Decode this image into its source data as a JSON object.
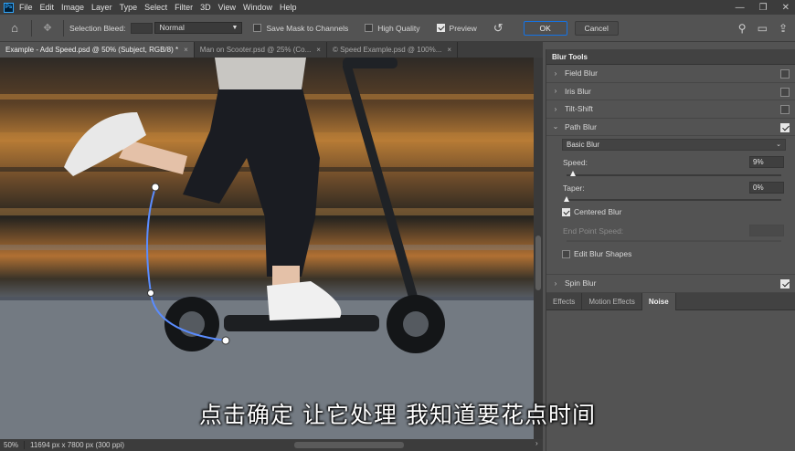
{
  "app": {
    "logo": "Ps"
  },
  "menu": [
    "File",
    "Edit",
    "Image",
    "Layer",
    "Type",
    "Select",
    "Filter",
    "3D",
    "View",
    "Window",
    "Help"
  ],
  "window_controls": {
    "minimize": "—",
    "restore": "❐",
    "close": "✕"
  },
  "options_bar": {
    "selection_bleed_label": "Selection Bleed:",
    "blend_mode": "Normal",
    "save_mask_label": "Save Mask to Channels",
    "save_mask_checked": false,
    "high_quality_label": "High Quality",
    "high_quality_checked": false,
    "preview_label": "Preview",
    "preview_checked": true,
    "ok_label": "OK",
    "cancel_label": "Cancel"
  },
  "tabs": [
    {
      "label": "Example - Add Speed.psd @ 50% (Subject, RGB/8) *",
      "active": true,
      "close": "×"
    },
    {
      "label": "Man on Scooter.psd @ 25% (Co...",
      "active": false,
      "close": "×"
    },
    {
      "label": "© Speed Example.psd @ 100%...",
      "active": false,
      "close": "×"
    }
  ],
  "subtitle": "点击确定 让它处理 我知道要花点时间",
  "status": {
    "zoom": "50%",
    "dimensions": "11694 px x 7800 px (300 ppi)",
    "arrow": "›"
  },
  "panel": {
    "title": "Blur Tools",
    "sections": [
      {
        "label": "Field Blur",
        "checked": false,
        "expanded": false
      },
      {
        "label": "Iris Blur",
        "checked": false,
        "expanded": false
      },
      {
        "label": "Tilt-Shift",
        "checked": false,
        "expanded": false
      },
      {
        "label": "Path Blur",
        "checked": true,
        "expanded": true
      }
    ],
    "path_blur": {
      "mode": "Basic Blur",
      "speed_label": "Speed:",
      "speed_value": "9%",
      "speed_fraction": 0.03,
      "taper_label": "Taper:",
      "taper_value": "0%",
      "taper_fraction": 0.0,
      "centered_blur_label": "Centered Blur",
      "centered_blur_checked": true,
      "end_point_speed_label": "End Point Speed:",
      "end_point_speed_value": "",
      "edit_shapes_label": "Edit Blur Shapes",
      "edit_shapes_checked": false
    },
    "spin_blur": {
      "label": "Spin Blur",
      "checked": true
    },
    "bottom_tabs": [
      {
        "label": "Effects",
        "active": false
      },
      {
        "label": "Motion Effects",
        "active": false
      },
      {
        "label": "Noise",
        "active": true
      }
    ]
  }
}
